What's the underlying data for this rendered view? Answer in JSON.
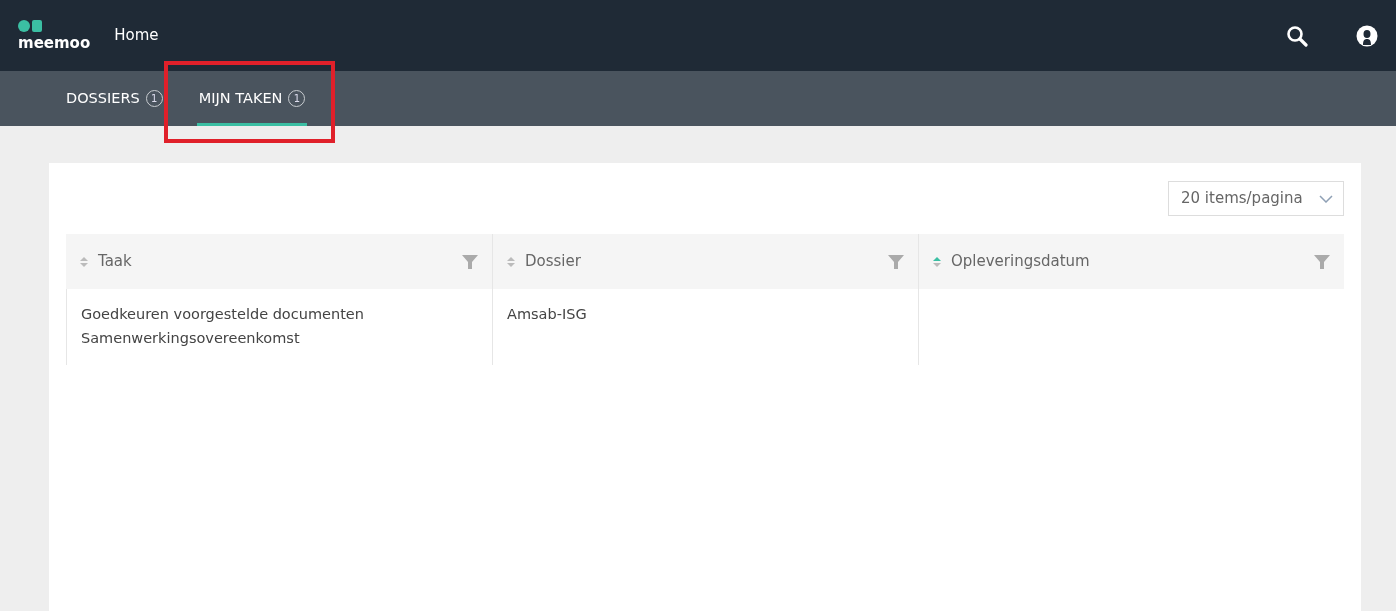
{
  "header": {
    "logo_text": "meemoo",
    "title": "Home"
  },
  "tabs": [
    {
      "label": "DOSSIERS",
      "count": "1",
      "selected": false,
      "highlighted": false
    },
    {
      "label": "MIJN TAKEN",
      "count": "1",
      "selected": true,
      "highlighted": true
    }
  ],
  "page_size": {
    "value": "20 items/pagina"
  },
  "table": {
    "columns": [
      {
        "label": "Taak",
        "sorted_ascending": false
      },
      {
        "label": "Dossier",
        "sorted_ascending": false
      },
      {
        "label": "Opleveringsdatum",
        "sorted_ascending": true
      }
    ],
    "rows": [
      [
        "Goedkeuren voorgestelde documenten Samenwerkingsovereenkomst",
        "Amsab-ISG",
        ""
      ]
    ]
  }
}
